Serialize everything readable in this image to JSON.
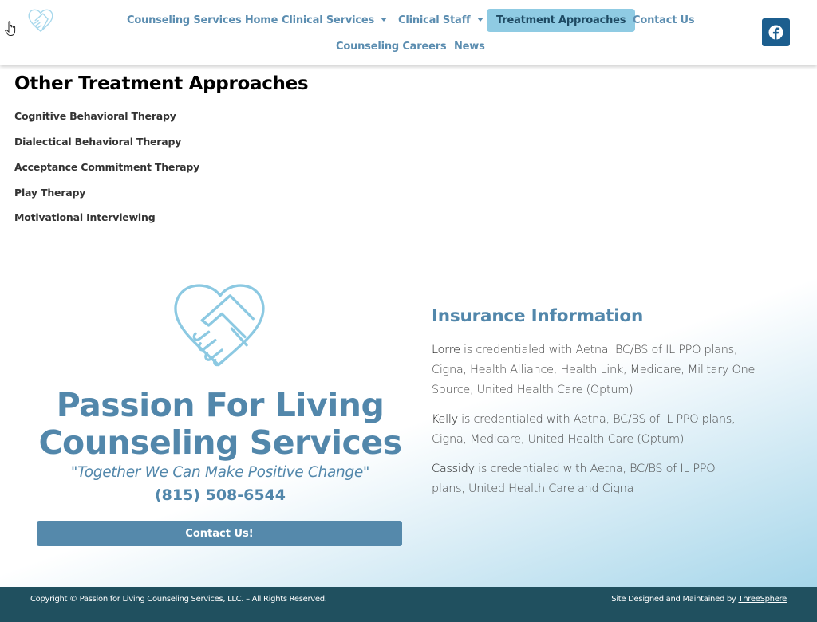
{
  "header": {
    "logo_alt": "Passion For Living heart handshake logo",
    "nav": [
      {
        "label": "Counseling Services Home",
        "dropdown": false,
        "active": false
      },
      {
        "label": "Clinical Services",
        "dropdown": true,
        "active": false
      },
      {
        "label": "Clinical Staff",
        "dropdown": true,
        "active": false
      },
      {
        "label": "Treatment Approaches",
        "dropdown": false,
        "active": true
      },
      {
        "label": "Contact Us",
        "dropdown": false,
        "active": false
      },
      {
        "label": "Counseling Careers",
        "dropdown": false,
        "active": false
      },
      {
        "label": "News",
        "dropdown": false,
        "active": false
      }
    ],
    "social": {
      "icon": "facebook-icon"
    }
  },
  "treatment": {
    "title": "Other Treatment Approaches",
    "items": [
      "Cognitive Behavioral Therapy",
      "Dialectical Behavioral Therapy",
      "Acceptance Commitment Therapy",
      "Play Therapy",
      "Motivational Interviewing"
    ]
  },
  "brand": {
    "line1": "Passion For Living",
    "line2": "Counseling Services",
    "tagline": "\"Together We Can Make Positive Change\"",
    "phone": "(815) 508-6544",
    "contact_button": "Contact Us!"
  },
  "insurance": {
    "title": "Insurance Information",
    "entries": [
      {
        "name": "Lorre",
        "text": " is credentialed with Aetna, BC/BS of IL PPO plans, Cigna, Health Alliance, Health Link, Medicare, Military One Source, United Health Care (Optum)"
      },
      {
        "name": "Kelly",
        "text": " is credentialed with Aetna, BC/BS of IL PPO plans, Cigna, Medicare, United Health Care (Optum)"
      },
      {
        "name": "Cassidy",
        "text": " is credentialed with Aetna, BC/BS of IL PPO plans, United Health Care and Cigna"
      }
    ]
  },
  "footer": {
    "copyright": "Copyright © Passion for Living Counseling Services, LLC. – All Rights Reserved.",
    "credit_prefix": "Site Designed and Maintained by ",
    "credit_link": "ThreeSphere"
  },
  "colors": {
    "brand_blue": "#5287ab",
    "nav_active_bg": "#8fcbe3",
    "facebook_bg": "#1c5e8e",
    "footer_bg": "#20505f",
    "logo_stroke": "#8cc9e2"
  }
}
